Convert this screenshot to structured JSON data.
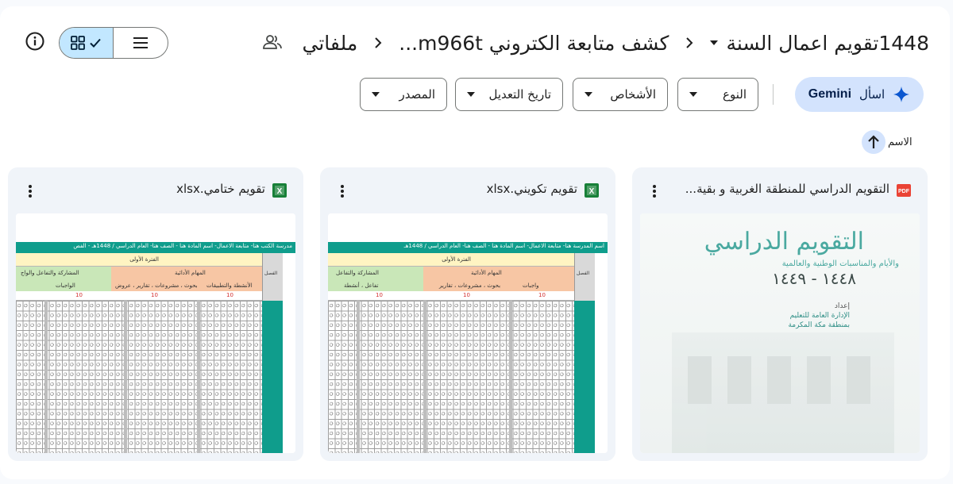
{
  "header": {
    "breadcrumbs": [
      {
        "label": "ملفاتي"
      },
      {
        "label": "كشف متابعة الكتروني m966t..."
      },
      {
        "label": "1448تقويم اعمال السنة"
      }
    ],
    "share_icon": "people-icon",
    "view_grid_icon": "grid-icon",
    "view_check_icon": "check-icon",
    "view_list_icon": "list-icon",
    "info_icon": "info-icon"
  },
  "filters": {
    "gemini": {
      "label": "اسأل",
      "brand": "Gemini",
      "icon": "sparkle-icon"
    },
    "chips": [
      {
        "label": "النوع"
      },
      {
        "label": "الأشخاص"
      },
      {
        "label": "تاريخ التعديل"
      },
      {
        "label": "المصدر"
      }
    ]
  },
  "sort": {
    "label": "الاسم",
    "icon": "arrow-up-icon"
  },
  "files": [
    {
      "name": "التقويم الدراسي للمنطقة الغربية و بقية...",
      "type": "PDF",
      "type_color": "#ea4335",
      "thumb": {
        "title": "التقويم الدراسي",
        "subtitle": "والأيام والمناسبات الوطنية والعالمية",
        "years": "١٤٤٨ - ١٤٤٩",
        "prep": "إعداد",
        "org1": "الإدارة العامة للتعليم",
        "org2": "بمنطقة مكة المكرمة"
      }
    },
    {
      "name": "تقويم تكويني.xlsx",
      "type": "XLSX",
      "type_color": "#188038",
      "thumb": {
        "header": "اسم المدرسة هنا- متابعة الاعمال- اسم المادة هنا - الصف هنا- العام الدراسي / 1448هـ",
        "period": "الفترة الأولى",
        "group_left": "المشاركة والتفاعل",
        "group_right": "المهام الأدائية",
        "sub1": "تفاعل ، أنشطة",
        "sub2": "بحوث ، مشروعات ، تقارير",
        "sub3": "واجبات",
        "side": "الفصل",
        "n1": "10",
        "n2": "10",
        "n3": "10"
      }
    },
    {
      "name": "تقويم ختامي.xlsx",
      "type": "XLSX",
      "type_color": "#188038",
      "thumb": {
        "header": "مدرسة الكتب هنا- متابعة الاعمال- اسم المادة هنا - الصف هنا- العام الدراسي / 1448هـ - الفص",
        "period": "الفترة الأولى",
        "group_left": "المشاركة والتفاعل والواج",
        "group_right": "المهام الأدائية",
        "sub1": "الواجبات",
        "sub2": "بحوث ، مشروعات ، تقارير ، عروض",
        "sub3": "الأنشطة والتطبيقات",
        "side": "الفصل",
        "n1": "10",
        "n2": "10",
        "n3": "10"
      }
    }
  ],
  "more_icon": "more-vert-icon"
}
